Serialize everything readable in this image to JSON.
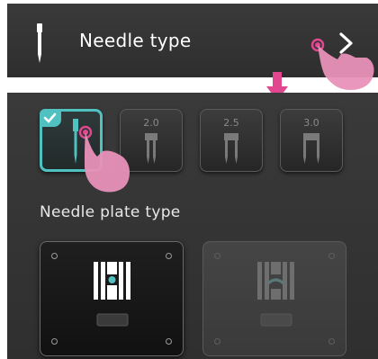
{
  "needle_type_row": {
    "icon": "needle-icon",
    "title": "Needle type",
    "next_icon": "chevron-right-icon"
  },
  "needle_sizes": [
    {
      "label": "",
      "icon": "single-needle-icon",
      "selected": true
    },
    {
      "label": "2.0",
      "icon": "twin-needle-icon",
      "selected": false
    },
    {
      "label": "2.5",
      "icon": "twin-needle-icon",
      "selected": false
    },
    {
      "label": "3.0",
      "icon": "twin-needle-icon",
      "selected": false
    }
  ],
  "needle_plate": {
    "label": "Needle plate type",
    "options": [
      {
        "icon": "straight-stitch-plate-icon",
        "enabled": true
      },
      {
        "icon": "zigzag-plate-icon",
        "enabled": false
      }
    ]
  },
  "colors": {
    "accent": "#4fc1c1",
    "indicator": "#e0478f",
    "panel": "#333333"
  }
}
